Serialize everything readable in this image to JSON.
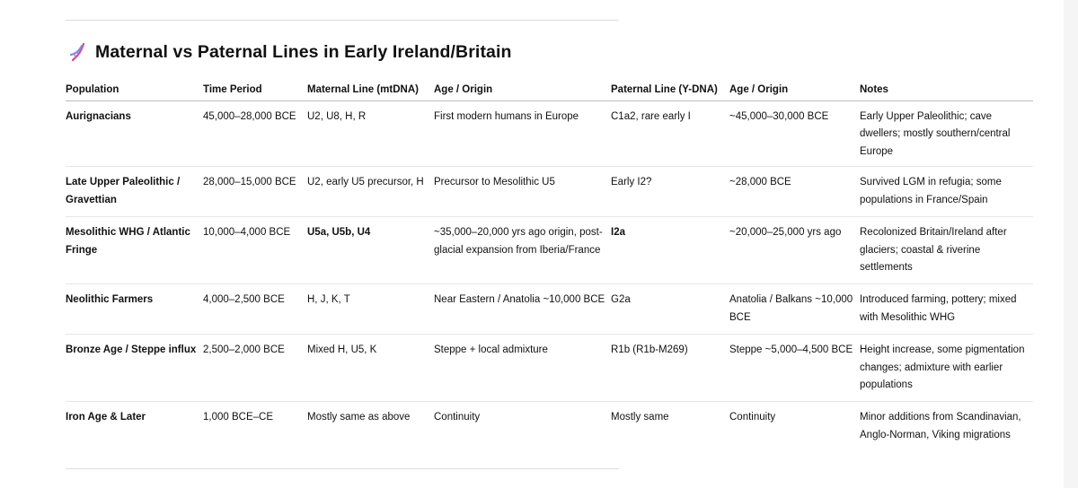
{
  "title": "Maternal vs Paternal Lines in Early Ireland/Britain",
  "title_icon": "dna-icon",
  "table": {
    "headers": [
      "Population",
      "Time Period",
      "Maternal Line (mtDNA)",
      "Age / Origin",
      "Paternal Line (Y-DNA)",
      "Age / Origin",
      "Notes"
    ],
    "rows": [
      [
        "Aurignacians",
        "45,000–28,000 BCE",
        "U2, U8, H, R",
        "First modern humans in Europe",
        "C1a2, rare early I",
        "~45,000–30,000 BCE",
        "Early Upper Paleolithic; cave dwellers; mostly southern/central Europe"
      ],
      [
        "Late Upper Paleolithic / Gravettian",
        "28,000–15,000 BCE",
        "U2, early U5 precursor, H",
        "Precursor to Mesolithic U5",
        "Early I2?",
        "~28,000 BCE",
        "Survived LGM in refugia; some populations in France/Spain"
      ],
      [
        "Mesolithic WHG / Atlantic Fringe",
        "10,000–4,000 BCE",
        "U5a, U5b, U4",
        "~35,000–20,000 yrs ago origin, post-glacial expansion from Iberia/France",
        "I2a",
        "~20,000–25,000 yrs ago",
        "Recolonized Britain/Ireland after glaciers; coastal & riverine settlements"
      ],
      [
        "Neolithic Farmers",
        "4,000–2,500 BCE",
        "H, J, K, T",
        "Near Eastern / Anatolia ~10,000 BCE",
        "G2a",
        "Anatolia / Balkans ~10,000 BCE",
        "Introduced farming, pottery; mixed with Mesolithic WHG"
      ],
      [
        "Bronze Age / Steppe influx",
        "2,500–2,000 BCE",
        "Mixed H, U5, K",
        "Steppe + local admixture",
        "R1b (R1b-M269)",
        "Steppe ~5,000–4,500 BCE",
        "Height increase, some pigmentation changes; admixture with earlier populations"
      ],
      [
        "Iron Age & Later",
        "1,000 BCE–CE",
        "Mostly same as above",
        "Continuity",
        "Mostly same",
        "Continuity",
        "Minor additions from Scandinavian, Anglo-Norman, Viking migrations"
      ]
    ],
    "bold_cells": [
      [
        2,
        2
      ],
      [
        2,
        4
      ]
    ]
  }
}
